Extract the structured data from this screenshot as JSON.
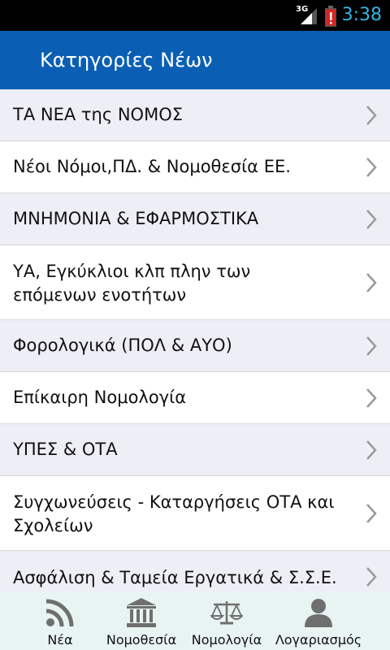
{
  "status_bar": {
    "network": "3G",
    "time": "3:38"
  },
  "app_bar": {
    "title": "Κατηγορίες Νέων"
  },
  "categories": [
    {
      "label": "ΤΑ ΝΕΑ της ΝΟΜΟΣ"
    },
    {
      "label": "Νέοι Νόμοι,ΠΔ. & Νομοθεσία ΕΕ."
    },
    {
      "label": "ΜΝΗΜΟΝΙΑ & ΕΦΑΡΜΟΣΤΙΚΑ"
    },
    {
      "label_line1": "ΥΑ, Εγκύκλιοι κλπ πλην των",
      "label_line2": "επόμενων ενοτήτων"
    },
    {
      "label": "Φορολογικά (ΠΟΛ & ΑΥΟ)"
    },
    {
      "label": "Επίκαιρη Νομολογία"
    },
    {
      "label": "ΥΠΕΣ & ΟΤΑ"
    },
    {
      "label_line1": "Συγχωνεύσεις - Καταργήσεις ΟΤΑ και",
      "label_line2": "Σχολείων"
    },
    {
      "label": "Ασφάλιση & Ταμεία Εργατικά & Σ.Σ.Ε."
    }
  ],
  "bottom_nav": [
    {
      "label": "Νέα",
      "icon": "rss-icon"
    },
    {
      "label": "Νομοθεσία",
      "icon": "building-icon"
    },
    {
      "label": "Νομολογία",
      "icon": "scales-icon"
    },
    {
      "label": "Λογαριασμός",
      "icon": "user-icon"
    }
  ]
}
